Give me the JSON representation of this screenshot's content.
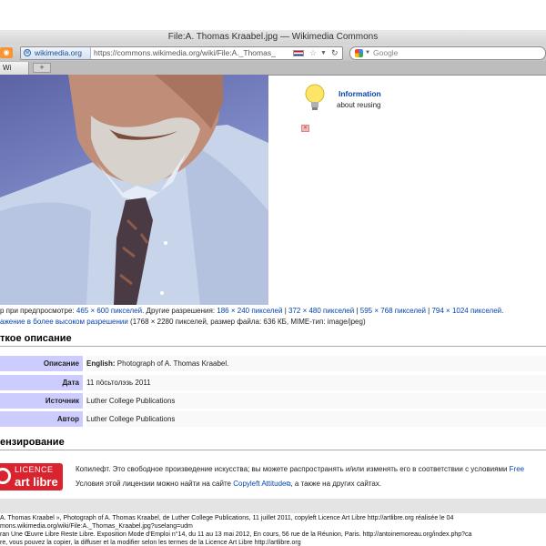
{
  "window": {
    "title": "File:A. Thomas Kraabel.jpg — Wikimedia Commons"
  },
  "toolbar": {
    "site_name": "wikimedia.org",
    "url": "https://commons.wikimedia.org/wiki/File:A._Thomas_",
    "search_placeholder": "Google"
  },
  "tabs": [
    {
      "label": "Wi"
    }
  ],
  "tab_add_label": "+",
  "info": {
    "title": "Information",
    "subtitle": "about reusing"
  },
  "resolutions": {
    "preview_prefix": "р при предпросмотре: ",
    "preview_size": "465 × 600 пикселей",
    "other_prefix": ". Другие разрешения: ",
    "r1": "186 × 240 пикселей",
    "r2": "372 × 480 пикселей",
    "r3": "595 × 768 пикселей",
    "r4": "794 × 1024 пикселей",
    "sep": " | ",
    "end": ".",
    "high_res_link": "ажение в более высоком разрешении",
    "high_res_details": " (1768 × 2280 пикселей, размер файла: 636 КБ, MIME-тип: image/jpeg)"
  },
  "summary": {
    "heading": "ткое описание",
    "rows": [
      {
        "label": "Описание",
        "value_bold": "English:",
        "value": " Photograph of A. Thomas Kraabel."
      },
      {
        "label": "Дата",
        "value_bold": "",
        "value": "11 пöсьтолэзь 2011"
      },
      {
        "label": "Источник",
        "value_bold": "",
        "value": "Luther College Publications"
      },
      {
        "label": "Автор",
        "value_bold": "",
        "value": "Luther College Publications"
      }
    ]
  },
  "license": {
    "heading": "ензирование",
    "logo_top": "LICENCE",
    "logo_bottom": "art libre",
    "line1": "Копилефт. Это свободное произведение искусства; вы можете распространять и/или изменять его в соответствии с условиями ",
    "line1_link": "Free",
    "line2_prefix": "Условия этой лицензии можно найти на сайте ",
    "line2_link": "Copyleft Attitude",
    "line2_suffix": ", а также на других сайтах."
  },
  "caption": {
    "l1": "A. Thomas Kraabel », Photograph of A. Thomas Kraabel, de Luther College Publications, 11 juillet 2011, copyleft Licence Art Libre http://artlibre.org réalisée le 04",
    "l2": "mons.wikimedia.org/wiki/File:A._Thomas_Kraabel.jpg?uselang=udm",
    "l3": "ran Une Œuvre Libre Reste Libre. Exposition Mode d'Emploi n°14, du 11 au 13 mai 2012, En cours, 56 rue de la Réunion, Paris. http://antoinemoreau.org/index.php?ca",
    "l4": "re, vous pouvez la copier, la diffuser et la modifier selon les termes de la Licence Art Libre http://artlibre.org"
  }
}
